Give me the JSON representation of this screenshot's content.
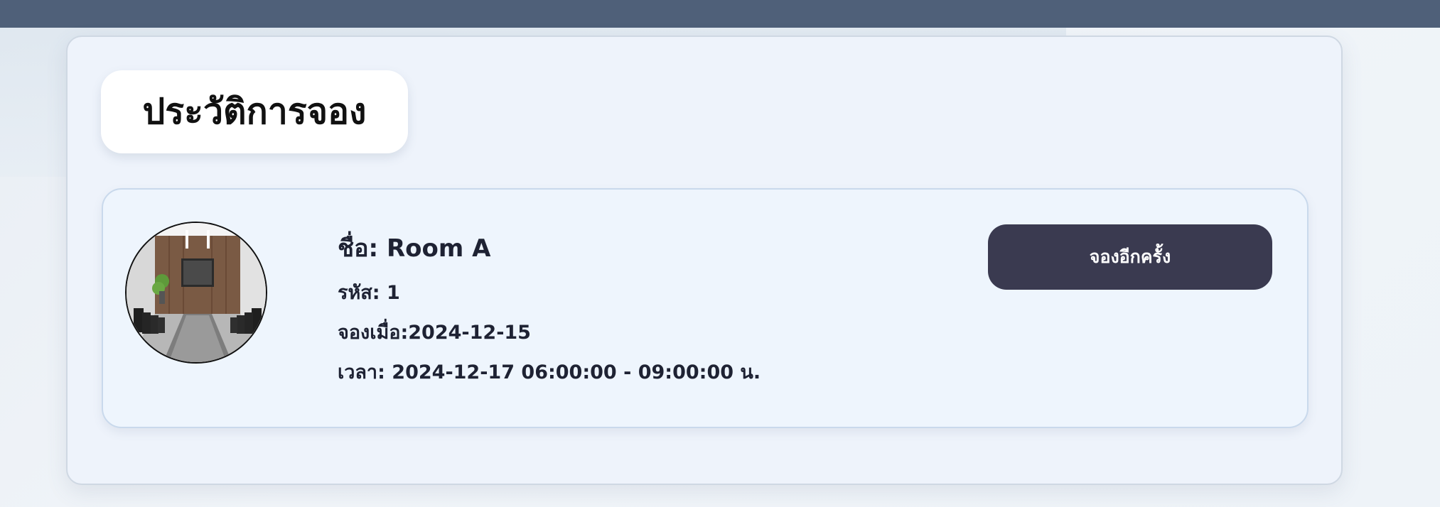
{
  "page": {
    "title": "ประวัติการจอง"
  },
  "booking": {
    "name_label": "ชื่อ: ",
    "name": "Room A",
    "code_label": "รหัส: ",
    "code": "1",
    "booked_at_label": "จองเมื่อ:",
    "booked_at": "2024-12-15",
    "time_label": "เวลา: ",
    "time_range": "2024-12-17 06:00:00 - 09:00:00 น.",
    "rebook_label": "จองอีกครั้ง",
    "image_icon": "meeting-room-photo"
  },
  "colors": {
    "topbar": "#4f6079",
    "button": "#3a3a50",
    "card_bg": "#eef5fd"
  }
}
